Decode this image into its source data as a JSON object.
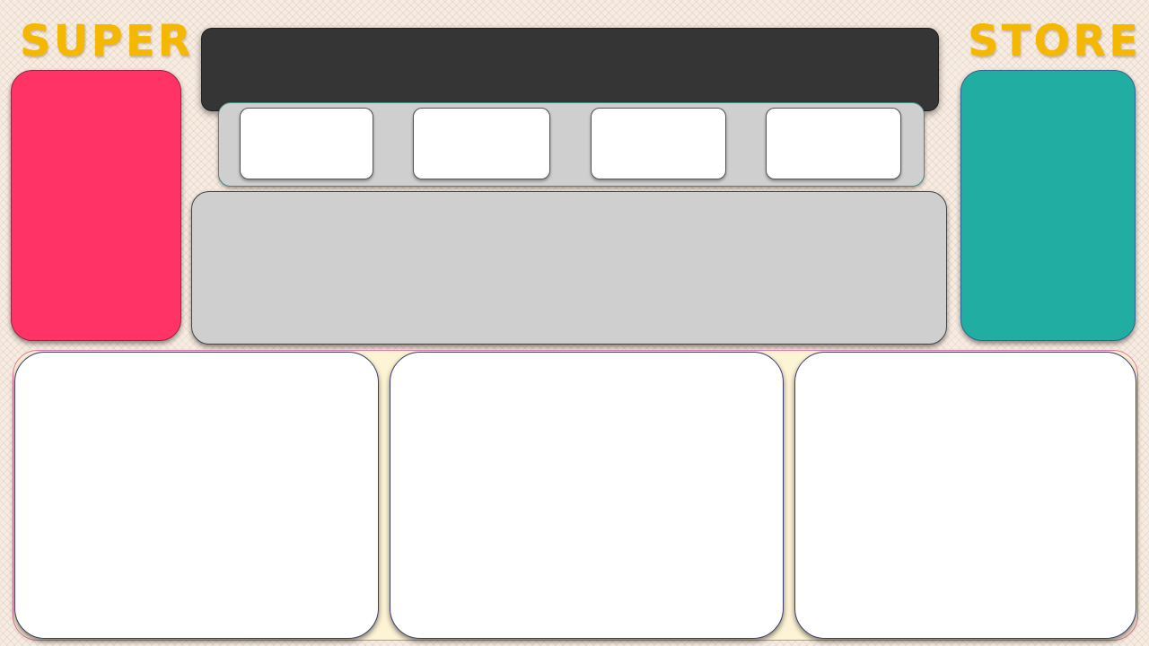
{
  "brand": {
    "left_word": "SUPER",
    "right_word": "STORE",
    "color": "#f5b800"
  },
  "colors": {
    "left_panel": "#ff3366",
    "right_panel": "#22ada3",
    "top_bar": "#353535",
    "panel_gray": "#d0cfd0",
    "bottom_tray": "#fdf3d5",
    "card": "#ffffff"
  }
}
